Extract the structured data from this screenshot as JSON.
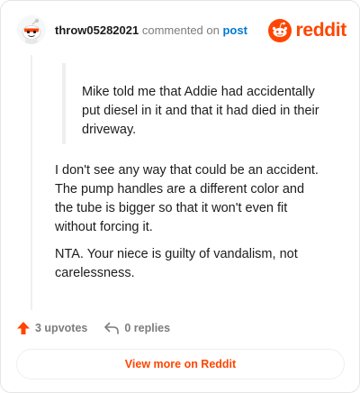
{
  "header": {
    "username": "throw05282021",
    "action_text": "commented on",
    "post_link_text": "post",
    "brand_name": "reddit"
  },
  "comment": {
    "quote_lines": [
      "Mike told me that Addie had accidentally",
      "put diesel in it and that it had died in their",
      "driveway."
    ],
    "paragraphs": [
      "I don't see any way that could be an accident. The pump handles are a different color and the tube is bigger so that it won't even fit without forcing it.",
      "NTA. Your niece is guilty of vandalism, not carelessness."
    ]
  },
  "footer": {
    "upvotes": "3 upvotes",
    "replies": "0 replies",
    "upvote_icon": "upvote-arrow-icon",
    "reply_icon": "reply-arrow-icon"
  },
  "view_more_label": "View more on Reddit",
  "colors": {
    "brand": "#ff4500",
    "link": "#0079d3",
    "muted": "#7c7c7c",
    "text": "#1c1c1c"
  }
}
